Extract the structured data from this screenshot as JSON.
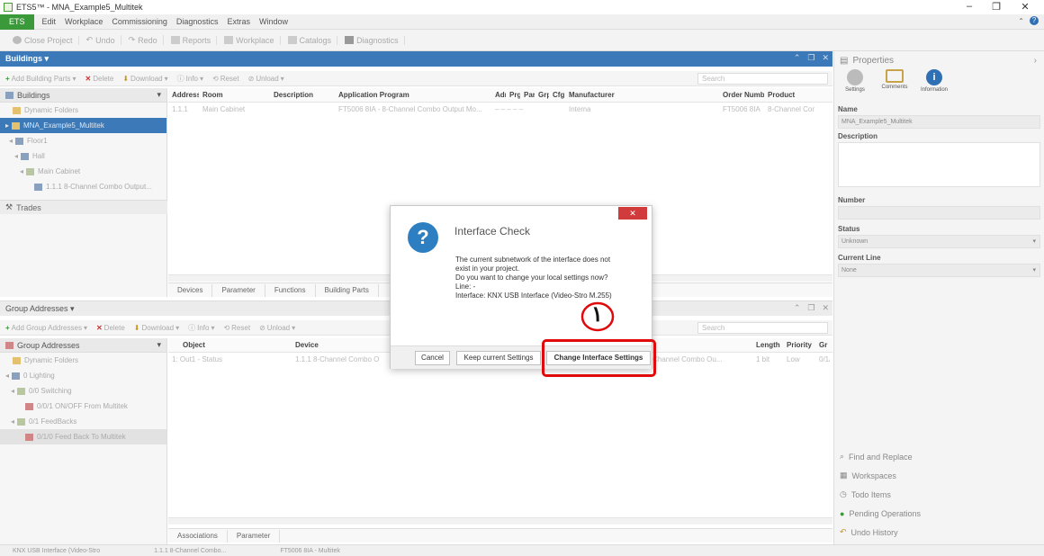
{
  "window": {
    "title": "ETS5™ - MNA_Example5_Multitek",
    "controls": [
      "–",
      "❐",
      "✕"
    ]
  },
  "menu": {
    "ets": "ETS",
    "items": [
      "Edit",
      "Workplace",
      "Commissioning",
      "Diagnostics",
      "Extras",
      "Window"
    ]
  },
  "toolbar": {
    "items": [
      "Close Project",
      "Undo",
      "Redo",
      "Reports",
      "Workplace",
      "Catalogs",
      "Diagnostics"
    ]
  },
  "buildings": {
    "header": "Buildings ▾",
    "actions": [
      "Add Building Parts",
      "Delete",
      "Download",
      "Info",
      "Reset",
      "Unload"
    ],
    "search_placeholder": "Search",
    "tree_header": "Buildings",
    "tree": [
      "Dynamic Folders",
      "MNA_Example5_Multitek",
      "Floor1",
      "Hall",
      "Main Cabinet",
      "1.1.1 8-Channel Combo Output..."
    ],
    "trades": "Trades",
    "columns": [
      "Address",
      "Room",
      "Description",
      "Application Program",
      "Adr",
      "Prg",
      "Par",
      "Grp",
      "Cfg",
      "Manufacturer",
      "Order Number",
      "Product"
    ],
    "row": {
      "address": "1.1.1",
      "room": "Main Cabinet",
      "description": "",
      "app": "FT5006 8IA - 8-Channel Combo Output Mo...",
      "flags": "–   –   –   –   –",
      "manufacturer": "Intema",
      "order": "FT5006 8IA",
      "product": "8-Channel Com"
    },
    "tabs": [
      "Devices",
      "Parameter",
      "Functions",
      "Building Parts"
    ]
  },
  "group_addresses": {
    "header": "Group Addresses ▾",
    "actions": [
      "Add Group Addresses",
      "Delete",
      "Download",
      "Info",
      "Reset",
      "Unload"
    ],
    "search_placeholder": "Search",
    "tree_header": "Group Addresses",
    "tree": [
      "Dynamic Folders",
      "0 Lighting",
      "0/0 Switching",
      "0/0/1 ON/OFF From Multitek",
      "0/1 FeedBacks",
      "0/1/0 Feed Back To Multitek"
    ],
    "columns": [
      "Object",
      "Device",
      "Length",
      "Priority",
      "Gr"
    ],
    "row": {
      "object": "1: Out1 - Status",
      "device": "1.1.1 8-Channel Combo O",
      "device_tail": "8-Channel Combo Ou...",
      "length": "1 bit",
      "priority": "Low",
      "gr": "0/1/"
    },
    "tabs": [
      "Associations",
      "Parameter"
    ]
  },
  "properties": {
    "title": "Properties",
    "tabs": [
      "Settings",
      "Comments",
      "Information"
    ],
    "name_label": "Name",
    "name_value": "MNA_Example5_Multitek",
    "description_label": "Description",
    "number_label": "Number",
    "status_label": "Status",
    "status_value": "Unknown",
    "current_line_label": "Current Line",
    "current_line_value": "None",
    "links": [
      "Find and Replace",
      "Workspaces",
      "Todo Items",
      "Pending Operations",
      "Undo History"
    ]
  },
  "status_bar": [
    "KNX USB Interface (Video-Stro",
    "1.1.1 8-Channel Combo...",
    "FT5006 8IA - Multitek"
  ],
  "dialog": {
    "close": "✕",
    "title": "Interface Check",
    "lines": [
      "The current subnetwork of the interface does not",
      "exist in your project.",
      "Do you want to change your local settings now?",
      "Line: -",
      "Interface: KNX USB Interface (Video-Stro    M.255)"
    ],
    "buttons": {
      "cancel": "Cancel",
      "keep": "Keep current Settings",
      "change": "Change Interface Settings"
    }
  },
  "annotation": {
    "number": "١",
    "color": "#e00a0a"
  }
}
